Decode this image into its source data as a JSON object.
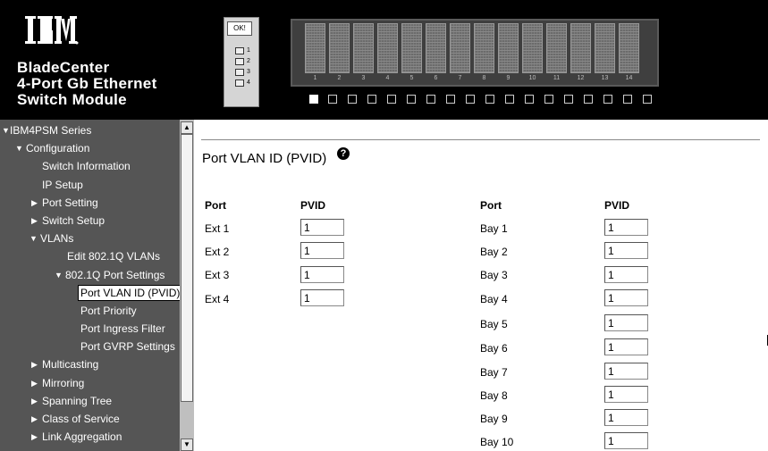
{
  "header": {
    "logo_text": "IBM",
    "brand_lines": [
      "BladeCenter",
      "4-Port Gb Ethernet",
      "Switch Module"
    ],
    "module_ok_label": "OK!",
    "module_ports": [
      "1",
      "2",
      "3",
      "4"
    ],
    "bays": [
      "1",
      "2",
      "3",
      "4",
      "5",
      "6",
      "7",
      "8",
      "9",
      "10",
      "11",
      "12",
      "13",
      "14"
    ],
    "selected_bay": "1"
  },
  "sidebar": {
    "items": [
      {
        "label": "IBM4PSM Series",
        "level": 0,
        "arrow": "▼"
      },
      {
        "label": "Configuration",
        "level": 1,
        "arrow": "▼"
      },
      {
        "label": "Switch Information",
        "level": 2,
        "arrow": ""
      },
      {
        "label": "IP Setup",
        "level": 2,
        "arrow": ""
      },
      {
        "label": "Port Setting",
        "level": 1,
        "arrow": "▶"
      },
      {
        "label": "Switch Setup",
        "level": 1,
        "arrow": "▶"
      },
      {
        "label": "VLANs",
        "level": 1,
        "arrow": "▼"
      },
      {
        "label": "Edit 802.1Q VLANs",
        "level": 3,
        "arrow": ""
      },
      {
        "label": "802.1Q Port Settings",
        "level": 2,
        "arrow": "▼"
      },
      {
        "label": "Port VLAN ID (PVID)",
        "level": 4,
        "arrow": "",
        "selected": true
      },
      {
        "label": "Port Priority",
        "level": 4,
        "arrow": ""
      },
      {
        "label": "Port Ingress Filter",
        "level": 4,
        "arrow": ""
      },
      {
        "label": "Port GVRP Settings",
        "level": 4,
        "arrow": ""
      },
      {
        "label": "Multicasting",
        "level": 1,
        "arrow": "▶"
      },
      {
        "label": "Mirroring",
        "level": 1,
        "arrow": "▶"
      },
      {
        "label": "Spanning Tree",
        "level": 1,
        "arrow": "▶"
      },
      {
        "label": "Class of Service",
        "level": 1,
        "arrow": "▶"
      },
      {
        "label": "Link Aggregation",
        "level": 1,
        "arrow": "▶"
      }
    ],
    "scroll_up_glyph": "▲",
    "scroll_down_glyph": "▼"
  },
  "main": {
    "title": "Port VLAN ID (PVID)",
    "help_glyph": "?",
    "left_table": {
      "headers": {
        "port": "Port",
        "pvid": "PVID"
      },
      "rows": [
        {
          "port": "Ext 1",
          "pvid": "1"
        },
        {
          "port": "Ext 2",
          "pvid": "1"
        },
        {
          "port": "Ext 3",
          "pvid": "1"
        },
        {
          "port": "Ext 4",
          "pvid": "1"
        }
      ]
    },
    "right_table": {
      "headers": {
        "port": "Port",
        "pvid": "PVID"
      },
      "rows": [
        {
          "port": "Bay 1",
          "pvid": "1"
        },
        {
          "port": "Bay 2",
          "pvid": "1"
        },
        {
          "port": "Bay 3",
          "pvid": "1"
        },
        {
          "port": "Bay 4",
          "pvid": "1"
        },
        {
          "port": "Bay 5",
          "pvid": "1"
        },
        {
          "port": "Bay 6",
          "pvid": "1"
        },
        {
          "port": "Bay 7",
          "pvid": "1"
        },
        {
          "port": "Bay 8",
          "pvid": "1"
        },
        {
          "port": "Bay 9",
          "pvid": "1"
        },
        {
          "port": "Bay 10",
          "pvid": "1"
        }
      ]
    }
  },
  "colors": {
    "header_bg": "#000000",
    "sidebar_bg": "#555555",
    "main_bg": "#ffffff"
  }
}
